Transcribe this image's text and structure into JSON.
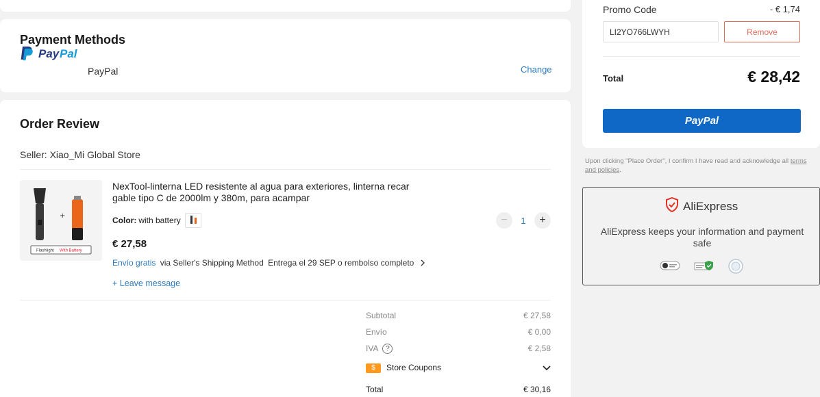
{
  "payment": {
    "title": "Payment Methods",
    "method_label": "PayPal",
    "logo_text": "PayPal",
    "change_label": "Change"
  },
  "review": {
    "title": "Order Review",
    "seller": "Seller: Xiao_Mi Global Store",
    "product": {
      "title": "NexTool-linterna LED resistente al agua para exteriores, linterna recar gable tipo C de 2000lm y 380m, para acampar",
      "color_label": "Color:",
      "color_value": "with battery",
      "price": "€ 27,58",
      "shipping_free": "Envío gratis",
      "shipping_method": "via Seller's Shipping Method",
      "delivery": "Entrega el 29 SEP o rembolso completo",
      "leave_message": "Leave message",
      "image_caption_a": "Flashlight",
      "image_caption_b": "With Battery",
      "quantity": "1"
    },
    "summary": {
      "subtotal_label": "Subtotal",
      "subtotal_value": "€ 27,58",
      "shipping_label": "Envío",
      "shipping_value": "€ 0,00",
      "tax_label": "IVA",
      "tax_value": "€ 2,58",
      "coupons_label": "Store Coupons",
      "total_label": "Total",
      "total_value": "€ 30,16"
    }
  },
  "order_summary": {
    "promo_label": "Promo Code",
    "promo_discount": "- € 1,74",
    "promo_code": "LI2YO766LWYH",
    "remove_label": "Remove",
    "total_label": "Total",
    "total_value": "€ 28,42",
    "pay_button_label": "PayPal",
    "disclaimer": "Upon clicking \"Place Order\", I confirm I have read and acknowledge all",
    "disclaimer_link": "terms and policies",
    "disclaimer_end": "."
  },
  "trust": {
    "brand": "AliExpress",
    "text": "AliExpress keeps your information and payment safe"
  },
  "colors": {
    "paypal_blue": "#0f68c5",
    "link_blue": "#2f7bbd",
    "remove_red": "#e06b5b",
    "coupon_orange": "#ff9a1f"
  }
}
